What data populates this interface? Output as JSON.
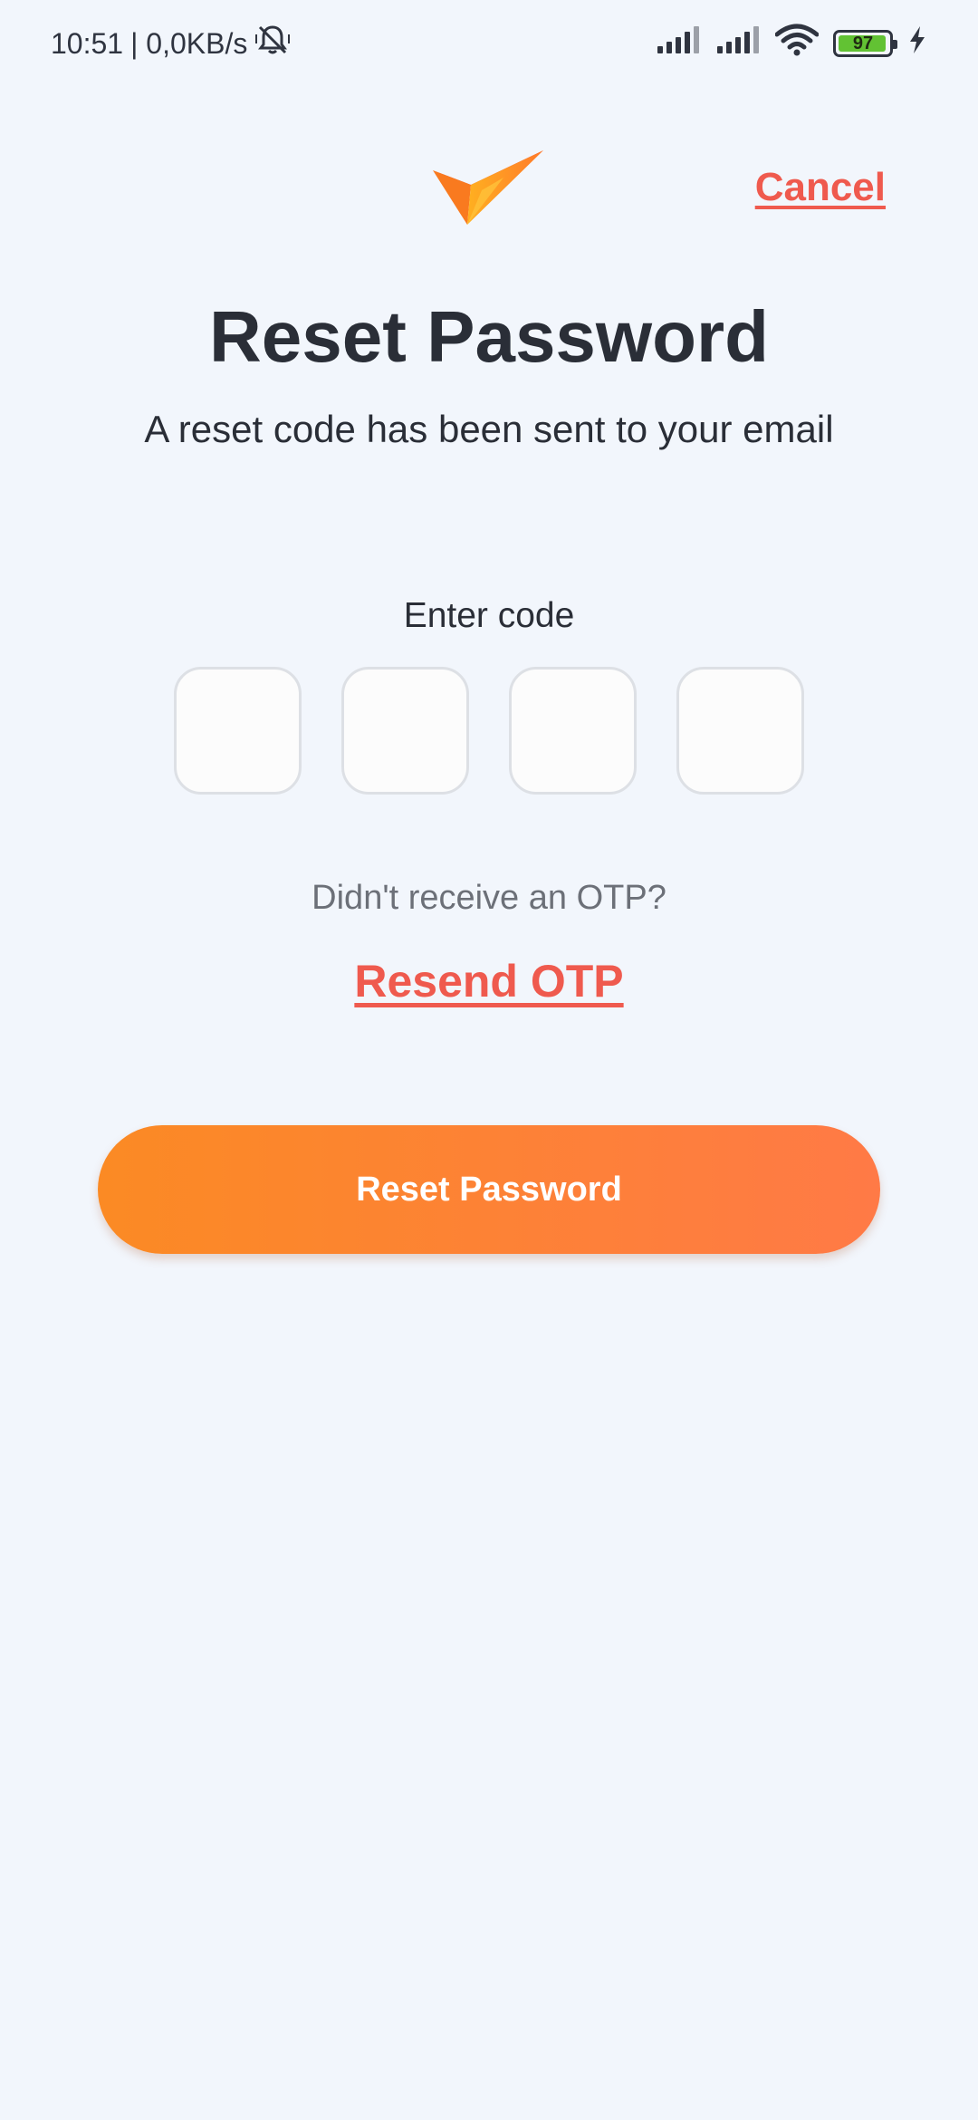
{
  "status_bar": {
    "time": "10:51",
    "network_speed": "| 0,0KB/s",
    "battery_level": "97",
    "icons": [
      "mute-bell-icon",
      "signal-icon",
      "signal-icon",
      "wifi-icon",
      "battery-icon",
      "charging-icon"
    ],
    "battery_fill_fraction": 0.97
  },
  "header": {
    "logo_icon": "brand-check-logo",
    "cancel_label": "Cancel"
  },
  "content": {
    "title": "Reset Password",
    "subtitle": "A reset code has been sent to your email",
    "code_label": "Enter code",
    "otp_fields": [
      {
        "value": ""
      },
      {
        "value": ""
      },
      {
        "value": ""
      },
      {
        "value": ""
      }
    ],
    "no_otp_text": "Didn't receive an OTP?",
    "resend_label": "Resend OTP",
    "submit_label": "Reset Password"
  },
  "colors": {
    "background": "#F2F6FC",
    "accent": "#EF5A4E",
    "button_gradient_start": "#FB8A24",
    "button_gradient_end": "#FF7A46",
    "text": "#2A2E37"
  }
}
